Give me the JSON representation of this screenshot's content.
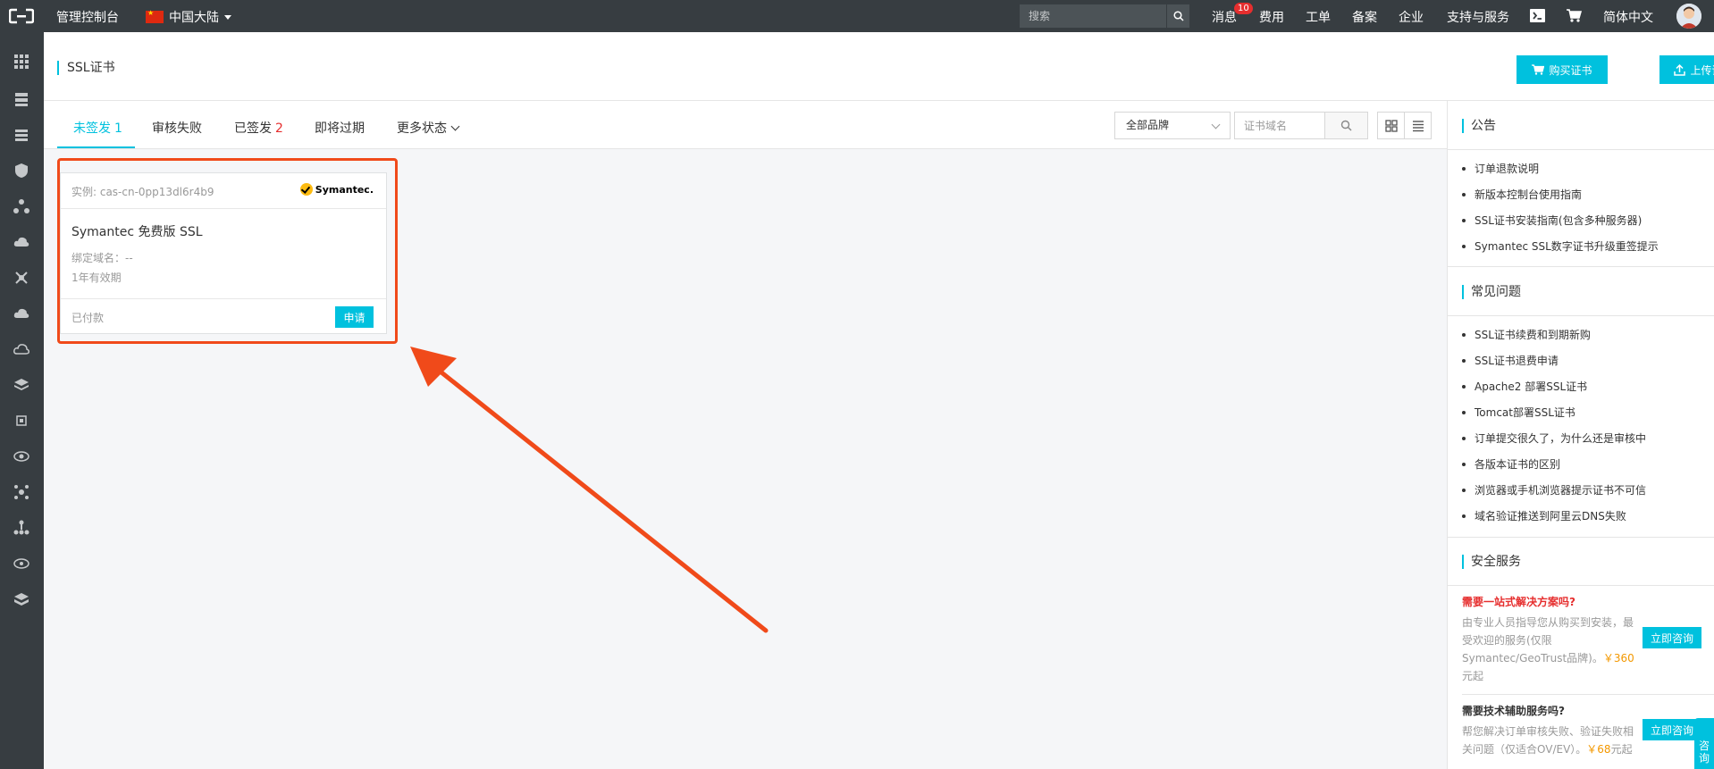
{
  "topbar": {
    "console_label": "管理控制台",
    "region_label": "中国大陆",
    "search_placeholder": "搜索",
    "nav": {
      "messages": "消息",
      "messages_count": "10",
      "billing": "费用",
      "tickets": "工单",
      "filing": "备案",
      "enterprise": "企业",
      "support": "支持与服务",
      "language": "简体中文"
    }
  },
  "header": {
    "title": "SSL证书",
    "buy_button": "购买证书",
    "upload_button": "上传证书"
  },
  "tabs": [
    {
      "label": "未签发",
      "count": "1"
    },
    {
      "label": "审核失败",
      "count": ""
    },
    {
      "label": "已签发",
      "count": "2"
    },
    {
      "label": "即将过期",
      "count": ""
    },
    {
      "label": "更多状态",
      "count": ""
    }
  ],
  "filters": {
    "brand_select": "全部品牌",
    "domain_placeholder": "证书域名"
  },
  "card": {
    "instance_label": "实例: cas-cn-0pp13dl6r4b9",
    "brand_logo": "Symantec.",
    "product_name": "Symantec 免费版 SSL",
    "domain_label": "绑定域名：--",
    "validity": "1年有效期",
    "status": "已付款",
    "apply_button": "申请"
  },
  "right_panel": {
    "announcements_title": "公告",
    "announcements": [
      "订单退款说明",
      "新版本控制台使用指南",
      "SSL证书安装指南(包含多种服务器)",
      "Symantec SSL数字证书升级重签提示"
    ],
    "faq_title": "常见问题",
    "faq": [
      "SSL证书续费和到期新购",
      "SSL证书退费申请",
      "Apache2 部署SSL证书",
      "Tomcat部署SSL证书",
      "订单提交很久了，为什么还是审核中",
      "各版本证书的区别",
      "浏览器或手机浏览器提示证书不可信",
      "域名验证推送到阿里云DNS失败"
    ],
    "security_title": "安全服务",
    "services": [
      {
        "title": "需要一站式解决方案吗?",
        "desc": "由专业人员指导您从购买到安装，最受欢迎的服务(仅限Symantec/GeoTrust品牌)。",
        "price": "￥360",
        "suffix": "元起",
        "button": "立即咨询"
      },
      {
        "title": "需要技术辅助服务吗?",
        "desc": "帮您解决订单审核失败、验证失败相关问题（仅适合OV/EV）。",
        "price": "￥68",
        "suffix": "元起",
        "button": "立即咨询"
      }
    ],
    "consult_float": "咨询"
  },
  "colors": {
    "accent": "#00c1de",
    "topbar_bg": "#373d41",
    "highlight": "#f04a1a",
    "count_red": "#e62e2e",
    "price": "#f39800"
  }
}
